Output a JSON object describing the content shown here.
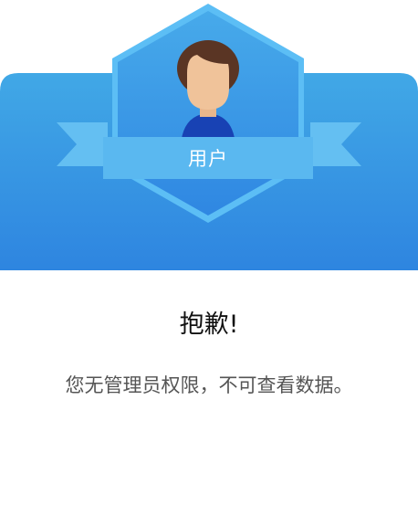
{
  "badge": {
    "role_label": "用户"
  },
  "dialog": {
    "title": "抱歉!",
    "message": "您无管理员权限，不可查看数据。"
  },
  "colors": {
    "header_gradient_top": "#41a8e6",
    "header_gradient_bottom": "#2e85e0",
    "hexagon_border": "#5cbef5",
    "ribbon": "#5ab8f0",
    "avatar_hair": "#5a3524",
    "avatar_face": "#f0c39a",
    "avatar_shirt": "#1842b4"
  }
}
